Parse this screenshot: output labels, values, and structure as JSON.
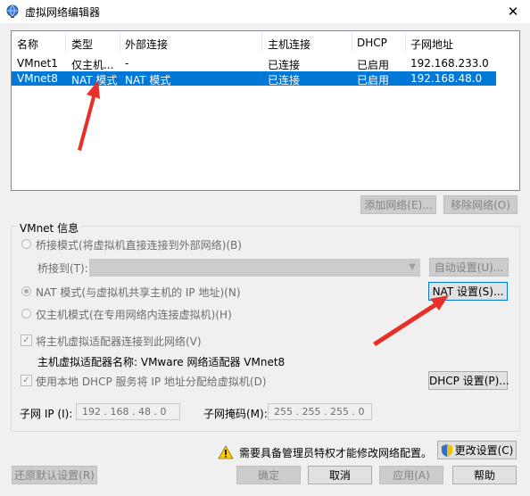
{
  "window": {
    "title": "虚拟网络编辑器",
    "close_glyph": "✕"
  },
  "network_list": {
    "columns": [
      "名称",
      "类型",
      "外部连接",
      "主机连接",
      "DHCP",
      "子网地址"
    ],
    "rows": [
      [
        "VMnet1",
        "仅主机...",
        "-",
        "已连接",
        "已启用",
        "192.168.233.0"
      ],
      [
        "VMnet8",
        "NAT 模式",
        "NAT 模式",
        "已连接",
        "已启用",
        "192.168.48.0"
      ]
    ],
    "selected_row": 1
  },
  "list_buttons": {
    "add": "添加网络(E)...",
    "remove": "移除网络(O)"
  },
  "vmnet_info": {
    "group_label": "VMnet 信息",
    "bridged_radio": "桥接模式(将虚拟机直接连接到外部网络)(B)",
    "bridge_to_label": "桥接到(T):",
    "bridge_to_value": "",
    "auto_settings": "自动设置(U)...",
    "nat_radio": "NAT 模式(与虚拟机共享主机的 IP 地址)(N)",
    "nat_settings": "NAT 设置(S)...",
    "hostonly_radio": "仅主机模式(在专用网络内连接虚拟机)(H)",
    "connect_adapter": "将主机虚拟适配器连接到此网络(V)",
    "adapter_name": "主机虚拟适配器名称: VMware 网络适配器 VMnet8",
    "use_dhcp": "使用本地 DHCP 服务将 IP 地址分配给虚拟机(D)",
    "dhcp_settings": "DHCP 设置(P)...",
    "subnet_ip_label": "子网 IP (I):",
    "subnet_ip_value": "192 . 168 . 48 . 0",
    "subnet_mask_label": "子网掩码(M):",
    "subnet_mask_value": "255 . 255 . 255 . 0",
    "selected_mode": "nat"
  },
  "admin_notice": {
    "text": "需要具备管理员特权才能修改网络配置。",
    "change_settings": "更改设置(C)"
  },
  "footer": {
    "restore": "还原默认设置(R)",
    "ok": "确定",
    "cancel": "取消",
    "apply": "应用(A)",
    "help": "帮助"
  },
  "annotation_color": "#e8302a"
}
